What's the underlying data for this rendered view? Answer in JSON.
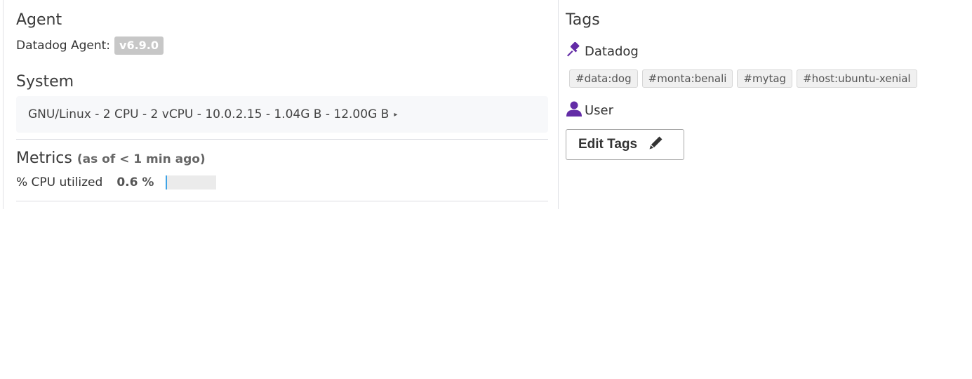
{
  "agent": {
    "title": "Agent",
    "label": "Datadog Agent:",
    "version": "v6.9.0"
  },
  "system": {
    "title": "System",
    "summary": "GNU/Linux - 2 CPU - 2 vCPU - 10.0.2.15 - 1.04G B - 12.00G B",
    "expand_icon": "caret-right-icon"
  },
  "metrics": {
    "title": "Metrics",
    "subtitle": "(as of < 1 min ago)",
    "cpu_label": "% CPU utilized",
    "cpu_value": "0.6 %",
    "cpu_percent": 0.6,
    "bar_color": "#3fa3e6"
  },
  "tags": {
    "title": "Tags",
    "sources": [
      {
        "name": "Datadog",
        "icon": "pin-icon",
        "icon_color": "#632ca6",
        "tags": [
          "#data:dog",
          "#monta:benali",
          "#mytag",
          "#host:ubuntu-xenial"
        ]
      },
      {
        "name": "User",
        "icon": "user-icon",
        "icon_color": "#632ca6",
        "tags": []
      }
    ],
    "edit_button_label": "Edit Tags",
    "edit_button_icon": "pencil-icon"
  }
}
